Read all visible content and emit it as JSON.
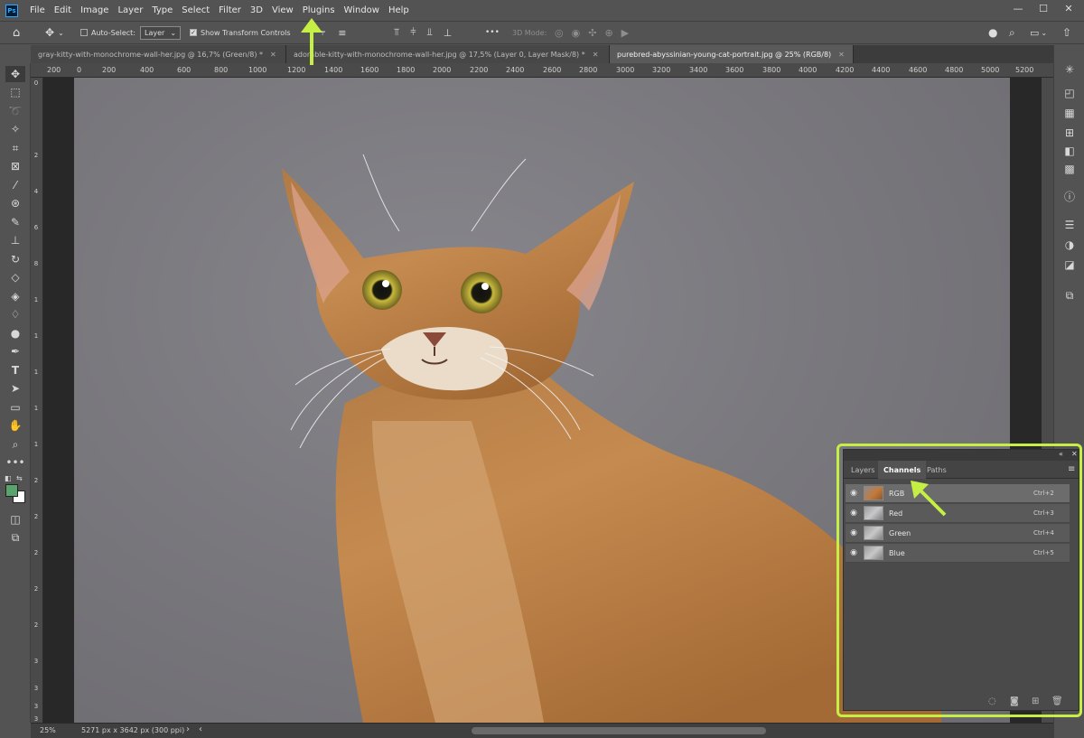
{
  "app": {
    "logo": "Ps"
  },
  "menu": [
    "File",
    "Edit",
    "Image",
    "Layer",
    "Type",
    "Select",
    "Filter",
    "3D",
    "View",
    "Plugins",
    "Window",
    "Help"
  ],
  "window_controls": {
    "minimize": "—",
    "maximize": "☐",
    "close": "✕"
  },
  "options": {
    "auto_select_label": "Auto-Select:",
    "auto_select_target": "Layer",
    "show_transform_label": "Show Transform Controls",
    "more_label": "•••",
    "mode_3d_label": "3D Mode:"
  },
  "tabs": [
    {
      "label": "gray-kitty-with-monochrome-wall-her.jpg @ 16,7% (Green/8) *",
      "active": false
    },
    {
      "label": "adorable-kitty-with-monochrome-wall-her.jpg @ 17,5% (Layer 0, Layer Mask/8) *",
      "active": false
    },
    {
      "label": "purebred-abyssinian-young-cat-portrait.jpg @ 25% (RGB/8)",
      "active": true
    }
  ],
  "ruler_top": [
    "0",
    "200",
    "400",
    "600",
    "800",
    "1000",
    "1200",
    "1400",
    "1600",
    "1800",
    "2000",
    "2200",
    "2400",
    "2600",
    "2800",
    "3000",
    "3200",
    "3400",
    "3600",
    "3800",
    "4000",
    "4200",
    "4400",
    "4600",
    "4800",
    "5000",
    "5200"
  ],
  "ruler_top_first": "200",
  "ruler_left": [
    "0",
    "2",
    "4",
    "6",
    "8",
    "1",
    "1",
    "1",
    "1",
    "1",
    "2",
    "2",
    "2",
    "2",
    "2",
    "3",
    "3",
    "3",
    "3"
  ],
  "status": {
    "zoom": "25%",
    "doc_info": "5271 px x 3642 px (300 ppi)"
  },
  "channels_panel": {
    "tabs": [
      "Layers",
      "Channels",
      "Paths"
    ],
    "active_tab": "Channels",
    "channels": [
      {
        "name": "RGB",
        "shortcut": "Ctrl+2"
      },
      {
        "name": "Red",
        "shortcut": "Ctrl+3"
      },
      {
        "name": "Green",
        "shortcut": "Ctrl+4"
      },
      {
        "name": "Blue",
        "shortcut": "Ctrl+5"
      }
    ]
  },
  "colors": {
    "accent_highlight": "#c6ef45",
    "foreground": "#5aa36d",
    "background": "#ffffff"
  }
}
